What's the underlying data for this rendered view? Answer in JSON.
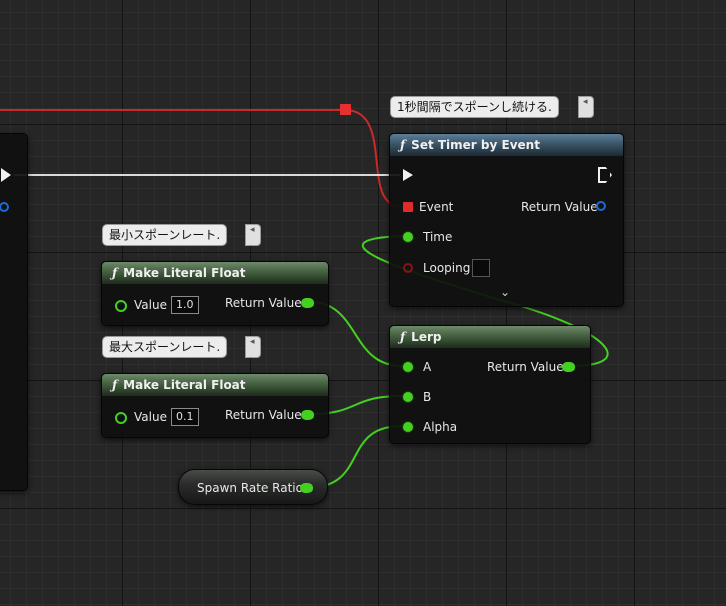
{
  "comments": {
    "timer": "1秒間隔でスポーンし続ける.",
    "min_rate": "最小スポーンレート.",
    "max_rate": "最大スポーンレート."
  },
  "set_timer": {
    "title": "Set Timer by Event",
    "event_label": "Event",
    "return_label": "Return Value",
    "time_label": "Time",
    "looping_label": "Looping"
  },
  "literal_min": {
    "title": "Make Literal Float",
    "value_label": "Value",
    "value": "1.0",
    "return_label": "Return Value"
  },
  "literal_max": {
    "title": "Make Literal Float",
    "value_label": "Value",
    "value": "0.1",
    "return_label": "Return Value"
  },
  "lerp": {
    "title": "Lerp",
    "a_label": "A",
    "b_label": "B",
    "alpha_label": "Alpha",
    "return_label": "Return Value"
  },
  "variable": {
    "label": "Spawn Rate Ratio"
  },
  "colors": {
    "exec_wire": "#d9d9d9",
    "float_wire": "#43d020",
    "delegate_wire": "#e02b2b"
  },
  "icons": {
    "function": "function-icon",
    "exec": "exec-pin-icon",
    "expand": "chevron-down-icon"
  }
}
